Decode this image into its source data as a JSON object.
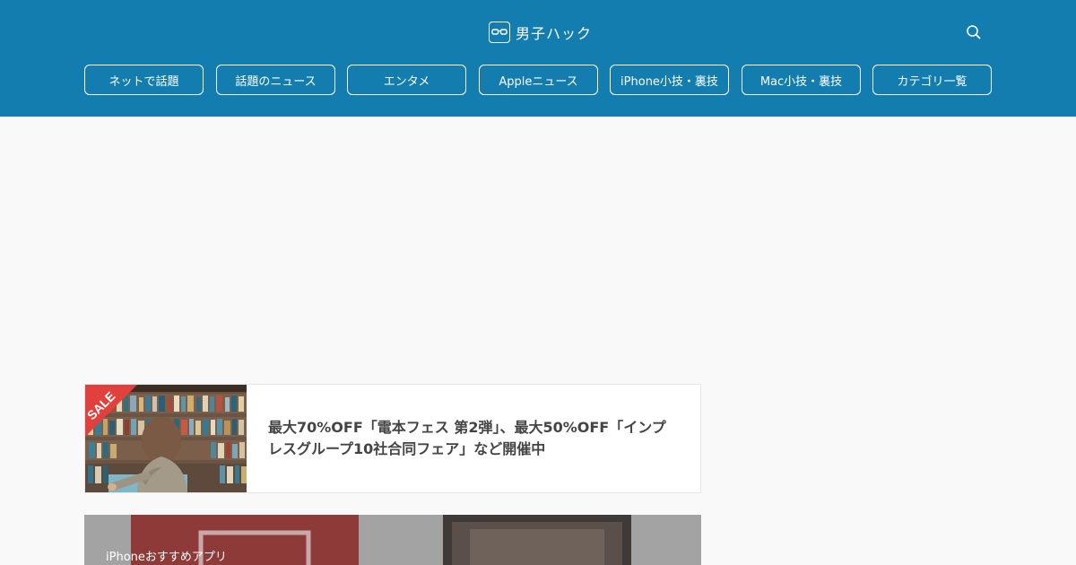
{
  "header": {
    "site_title": "男子ハック",
    "logo_icon": "glasses-icon",
    "search_icon": "search-icon",
    "background_color": "#137daf"
  },
  "nav": {
    "items": [
      {
        "label": "ネットで話題"
      },
      {
        "label": "話題のニュース"
      },
      {
        "label": "エンタメ"
      },
      {
        "label": "Appleニュース"
      },
      {
        "label": "iPhone小技・裏技"
      },
      {
        "label": "Mac小技・裏技"
      },
      {
        "label": "カテゴリ一覧"
      }
    ]
  },
  "articles": [
    {
      "title": "最大70%OFF「電本フェス 第2弾」、最大50%OFF「インプレスグループ10社合同フェア」など開催中",
      "thumbnail_badge": "SALE"
    }
  ],
  "featured": {
    "category_label": "iPhoneおすすめアプリ"
  }
}
